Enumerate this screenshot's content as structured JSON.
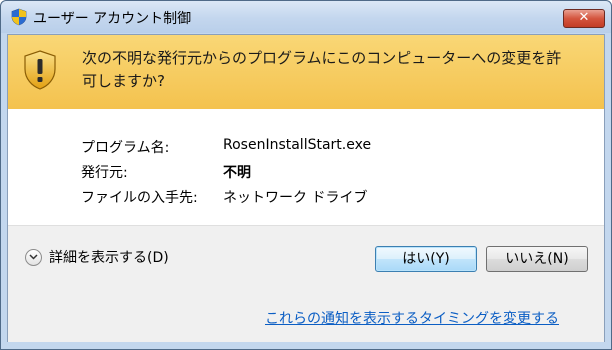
{
  "window": {
    "title": "ユーザー アカウント制御",
    "close_label": "✕"
  },
  "banner": {
    "line1": "次の不明な発行元からのプログラムにこのコンピューターへの変更を許",
    "line2": "可しますか?"
  },
  "info": [
    {
      "label": "プログラム名:",
      "value": "RosenInstallStart.exe",
      "bold": false
    },
    {
      "label": "発行元:",
      "value": "不明",
      "bold": true
    },
    {
      "label": "ファイルの入手先:",
      "value": "ネットワーク ドライブ",
      "bold": false
    }
  ],
  "footer": {
    "details_label": "詳細を表示する(D)",
    "yes_label": "はい(Y)",
    "no_label": "いいえ(N)",
    "notify_link": "これらの通知を表示するタイミングを変更する"
  },
  "colors": {
    "banner": "#f4c24e",
    "link": "#0b5ec4",
    "close_button": "#c23c25"
  },
  "icons": {
    "title": "uac-shield-icon",
    "banner": "warning-shield-icon",
    "details": "chevron-down-icon"
  }
}
